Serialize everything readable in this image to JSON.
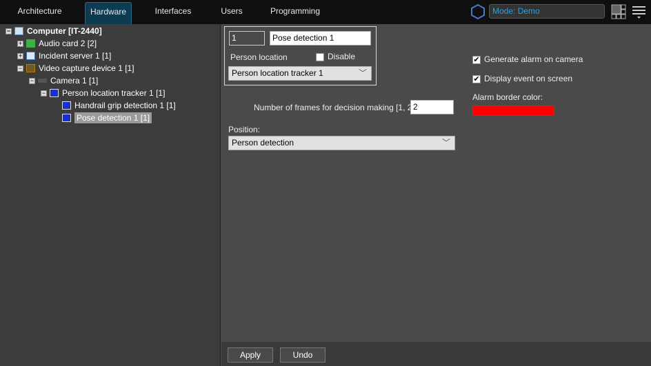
{
  "tabs": [
    "Architecture",
    "Hardware",
    "Interfaces",
    "Users",
    "Programming"
  ],
  "mode": "Mode: Demo",
  "tree": [
    {
      "label": "Computer [IT-2440]",
      "icon": "computer-icon"
    },
    {
      "label": "Audio card 2 [2]",
      "icon": "audio-card-icon"
    },
    {
      "label": "Incident server 1 [1]",
      "icon": "server-icon"
    },
    {
      "label": "Video capture device 1 [1]",
      "icon": "capture-device-icon"
    },
    {
      "label": "Camera 1 [1]",
      "icon": "camera-icon"
    },
    {
      "label": "Person location tracker 1 [1]",
      "icon": "detector-icon"
    },
    {
      "label": "Handrail grip detection 1 [1]",
      "icon": "detector-icon"
    },
    {
      "label": "Pose detection 1 [1]",
      "icon": "detector-icon"
    }
  ],
  "form": {
    "id": "1",
    "name": "Pose detection 1",
    "person_location_label": "Person location",
    "disable_label": "Disable",
    "tracker": "Person location tracker 1",
    "frames_label": "Number of frames for decision making [1, 20]:",
    "frames": "2",
    "position_label": "Position:",
    "position": "Person detection",
    "generate_alarm": "Generate alarm on camera",
    "display_event": "Display event on screen",
    "alarm_color_label": "Alarm border color:",
    "alarm_color": "#ff0000"
  },
  "buttons": {
    "apply": "Apply",
    "undo": "Undo"
  }
}
